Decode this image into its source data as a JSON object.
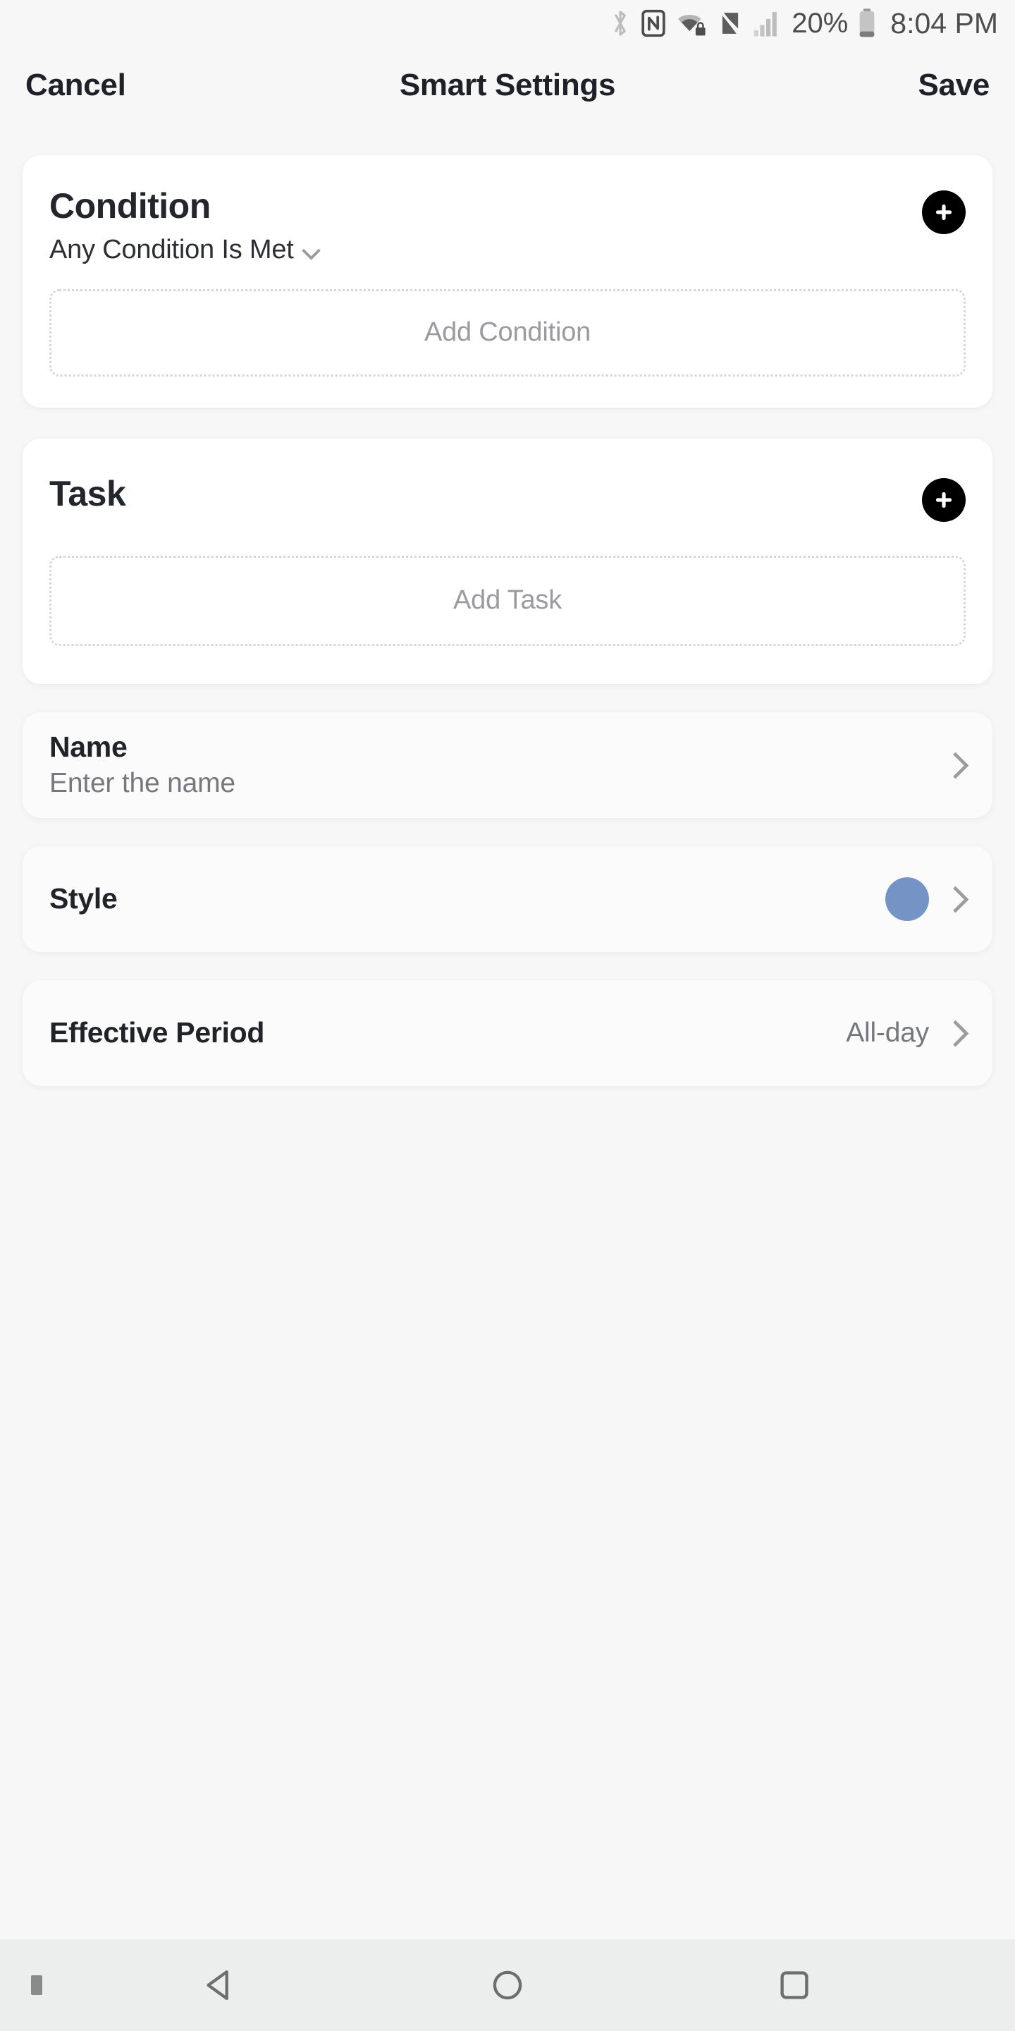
{
  "status_bar": {
    "icons": [
      {
        "name": "bluetooth-icon",
        "label": "Bluetooth"
      },
      {
        "name": "nfc-icon",
        "label": "NFC"
      },
      {
        "name": "wifi-lock-icon",
        "label": "Wi-Fi secured"
      },
      {
        "name": "mute-icon",
        "label": "Sound off"
      },
      {
        "name": "signal-bars-icon",
        "label": "Cellular signal"
      }
    ],
    "battery_percent": "20%",
    "battery_icon": "battery-icon",
    "time": "8:04 PM"
  },
  "header": {
    "cancel_label": "Cancel",
    "title": "Smart Settings",
    "save_label": "Save"
  },
  "condition_section": {
    "title": "Condition",
    "mode_label": "Any Condition Is Met",
    "mode_chevron": "chevron-down-icon",
    "add_button_icon": "plus-icon",
    "add_placeholder": "Add Condition"
  },
  "task_section": {
    "title": "Task",
    "add_button_icon": "plus-icon",
    "add_placeholder": "Add Task"
  },
  "rows": [
    {
      "name_key": "name-row",
      "title": "Name",
      "subtitle": "Enter the name",
      "value": "",
      "swatch_color": "",
      "chevron": "chevron-right-icon"
    },
    {
      "name_key": "style-row",
      "title": "Style",
      "subtitle": "",
      "value": "",
      "swatch_color": "#7593c4",
      "chevron": "chevron-right-icon"
    },
    {
      "name_key": "effective-period-row",
      "title": "Effective Period",
      "subtitle": "",
      "value": "All-day",
      "swatch_color": "",
      "chevron": "chevron-right-icon"
    }
  ],
  "nav_bar": {
    "back_label": "Back",
    "home_label": "Home",
    "recents_label": "Recents"
  },
  "colors": {
    "page_background": "#f7f7f7",
    "card_background": "#ffffff",
    "accent_style_swatch": "#7593c4",
    "primary_text": "#1f2128",
    "secondary_text": "#76787d",
    "placeholder_text": "#9b9b9f",
    "add_button": "#000000",
    "nav_bar_background": "#eceded"
  }
}
